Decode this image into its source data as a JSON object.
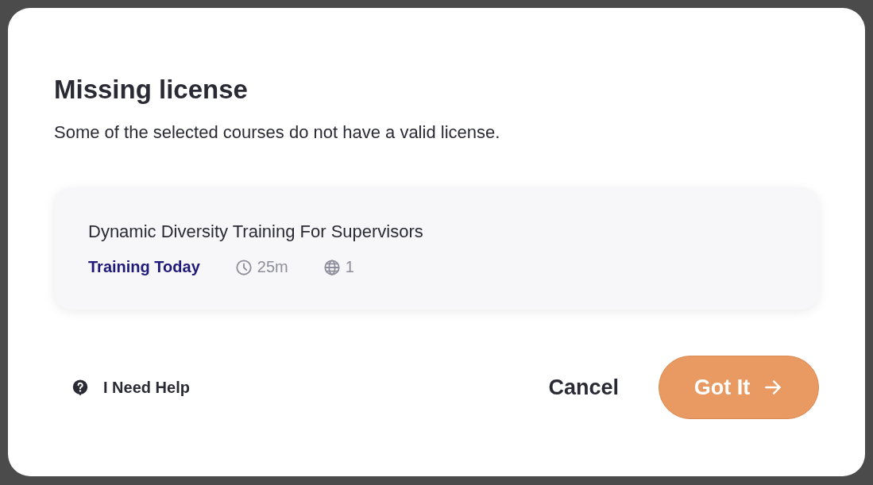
{
  "dialog": {
    "title": "Missing license",
    "message": "Some of the selected courses do not have a valid license.",
    "courses": [
      {
        "title": "Dynamic Diversity Training For Supervisors",
        "provider": "Training Today",
        "duration": "25m",
        "languages": "1"
      }
    ],
    "help_link": "I Need Help",
    "buttons": [
      {
        "kind": "secondary",
        "label": "Cancel"
      },
      {
        "kind": "primary",
        "label": "Got It"
      }
    ]
  }
}
